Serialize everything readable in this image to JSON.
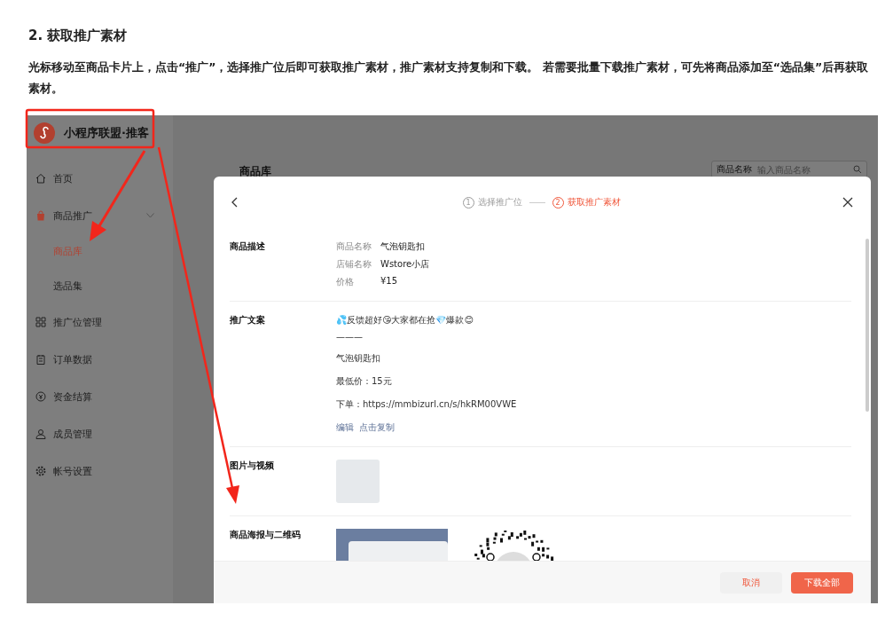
{
  "doc": {
    "heading": "2. 获取推广素材",
    "paragraph": "光标移动至商品卡片上，点击“推广”，选择推广位后即可获取推广素材，推广素材支持复制和下载。 若需要批量下载推广素材，可先将商品添加至“选品集”后再获取素材。"
  },
  "app": {
    "brand": "小程序联盟·推客",
    "sidebar": [
      {
        "label": "首页",
        "selected": false
      },
      {
        "label": "商品推广",
        "selected": false,
        "expanded": true,
        "children": [
          {
            "label": "商品库",
            "selected": true
          },
          {
            "label": "选品集",
            "selected": false
          }
        ]
      },
      {
        "label": "推广位管理",
        "selected": false
      },
      {
        "label": "订单数据",
        "selected": false
      },
      {
        "label": "资金结算",
        "selected": false
      },
      {
        "label": "成员管理",
        "selected": false
      },
      {
        "label": "帐号设置",
        "selected": false
      }
    ],
    "page_title": "商品库",
    "search": {
      "filter": "商品名称",
      "placeholder": "输入商品名称"
    }
  },
  "modal": {
    "steps": [
      {
        "number": "1",
        "label": "选择推广位",
        "selected": false
      },
      {
        "number": "2",
        "label": "获取推广素材",
        "selected": true
      }
    ],
    "sections": [
      {
        "kind": "fields",
        "title": "商品描述",
        "fields": [
          {
            "label": "商品名称",
            "value": "气泡钥匙扣"
          },
          {
            "label": "店铺名称",
            "value": "Wstore小店"
          },
          {
            "label": "价格",
            "value": "¥15"
          }
        ]
      },
      {
        "kind": "copy",
        "title": "推广文案",
        "lines": [
          "💦反馈超好😘大家都在抢💎爆款😊",
          "———",
          "气泡钥匙扣",
          "最低价：15元",
          "下单：https://mmbizurl.cn/s/hkRM00VWE"
        ],
        "links": [
          "编辑",
          "点击复制"
        ]
      },
      {
        "kind": "images",
        "title": "图片与视频"
      },
      {
        "kind": "poster",
        "title": "商品海报与二维码"
      }
    ],
    "buttons": [
      {
        "label": "取消",
        "kind": "secondary"
      },
      {
        "label": "下载全部",
        "kind": "primary"
      }
    ]
  }
}
